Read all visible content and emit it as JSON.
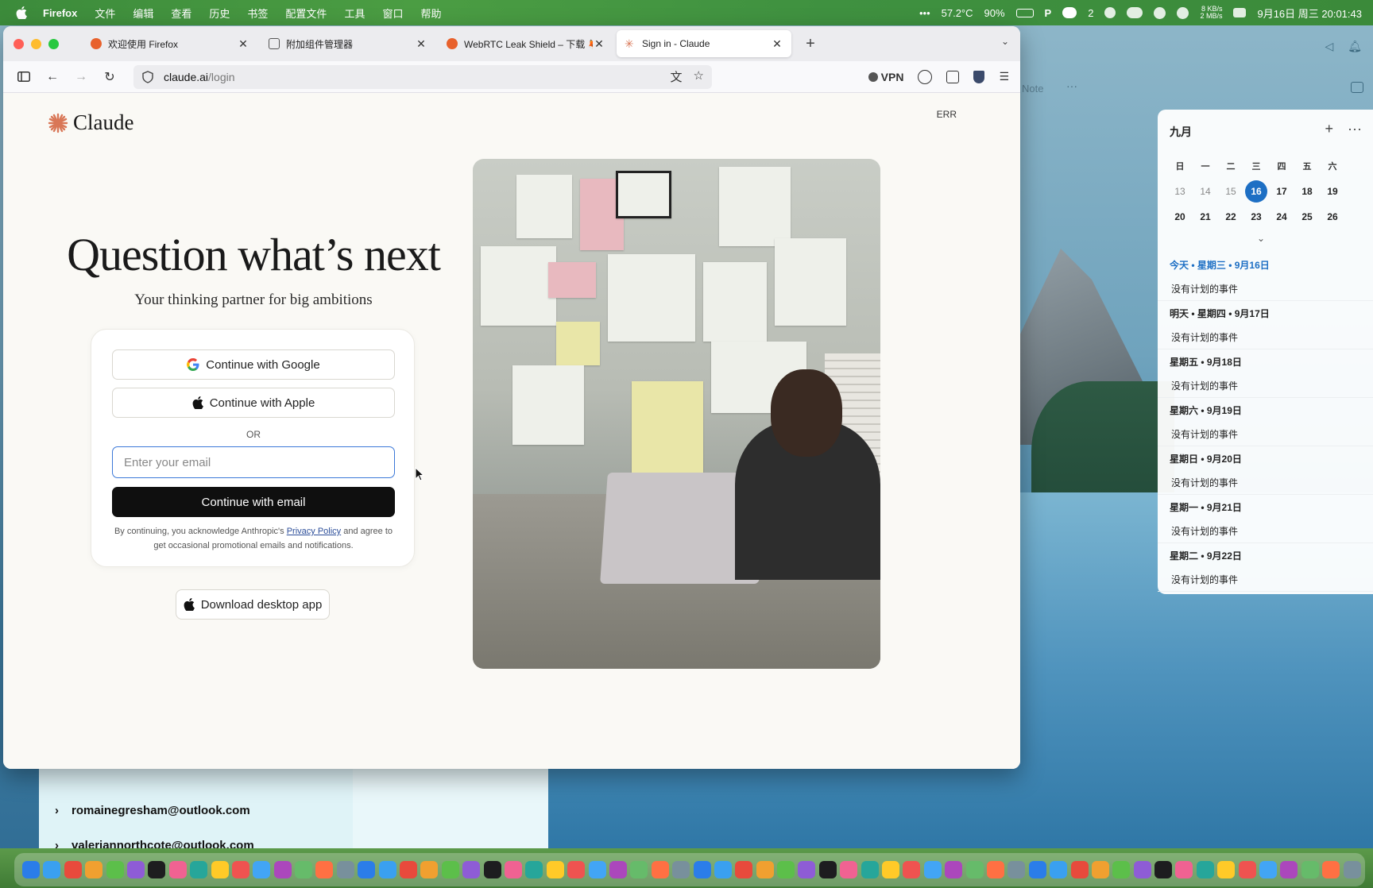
{
  "menubar": {
    "app_name": "Firefox",
    "items": [
      "文件",
      "编辑",
      "查看",
      "历史",
      "书签",
      "配置文件",
      "工具",
      "窗口",
      "帮助"
    ],
    "status": {
      "temperature": "57.2°C",
      "battery": "90%",
      "wechat_count": "2",
      "network_up": "8 KB/s",
      "network_down": "2 MB/s",
      "datetime": "9月16日 周三 20:01:43"
    }
  },
  "browser": {
    "tabs": [
      {
        "label": "欢迎使用 Firefox",
        "favicon_color": "#e8612c"
      },
      {
        "label": "附加组件管理器",
        "favicon_color": "#555555"
      },
      {
        "label": "WebRTC Leak Shield – 下载 🦊 F",
        "favicon_color": "#e8612c"
      },
      {
        "label": "Sign in - Claude",
        "favicon_color": "#d97757",
        "active": true
      }
    ],
    "url_host": "claude.ai",
    "url_path": "/login",
    "vpn_label": "VPN"
  },
  "page": {
    "brand": "Claude",
    "brand_color": "#d97757",
    "err_label": "ERR",
    "headline": "Question what’s next",
    "subhead": "Your thinking partner for big ambitions",
    "google_button": "Continue with Google",
    "apple_button": "Continue with Apple",
    "or_label": "OR",
    "email_placeholder": "Enter your email",
    "email_button": "Continue with email",
    "legal_prefix": "By continuing, you acknowledge Anthropic's",
    "legal_link": "Privacy Policy",
    "legal_suffix": "and agree to get occasional promotional emails and notifications.",
    "download_button": "Download desktop app"
  },
  "background_mail": {
    "rows": [
      "romainegresham@outlook.com",
      "valeriannorthcote@outlook.com"
    ]
  },
  "notes_panel": {
    "label": "Note",
    "more": "···"
  },
  "calendar": {
    "month": "九月",
    "weekdays": [
      "日",
      "一",
      "二",
      "三",
      "四",
      "五",
      "六"
    ],
    "week1": [
      "13",
      "14",
      "15",
      "16",
      "17",
      "18",
      "19"
    ],
    "week2": [
      "20",
      "21",
      "22",
      "23",
      "24",
      "25",
      "26"
    ],
    "today_color": "#1d6fc4",
    "agenda": [
      {
        "day": "今天 • 星期三 • 9月16日",
        "event": "没有计划的事件",
        "today": true
      },
      {
        "day": "明天 • 星期四 • 9月17日",
        "event": "没有计划的事件"
      },
      {
        "day": "星期五 • 9月18日",
        "event": "没有计划的事件"
      },
      {
        "day": "星期六 • 9月19日",
        "event": "没有计划的事件"
      },
      {
        "day": "星期日 • 9月20日",
        "event": "没有计划的事件"
      },
      {
        "day": "星期一 • 9月21日",
        "event": "没有计划的事件"
      },
      {
        "day": "星期二 • 9月22日",
        "event": "没有计划的事件"
      }
    ]
  }
}
